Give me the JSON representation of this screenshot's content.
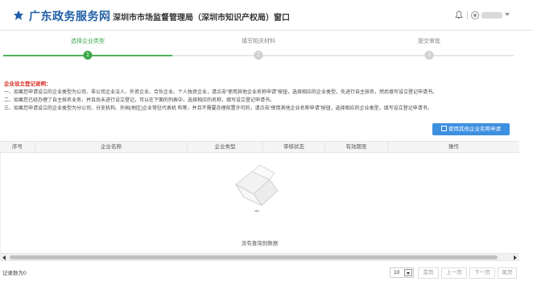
{
  "header": {
    "brand": "广东政务服务网",
    "window_title": "深圳市市场监督管理局（深圳市知识产权局）窗口",
    "logo_icon": "gd-gov-logo-icon",
    "bell_icon": "bell-icon",
    "user_icon": "user-avatar-icon"
  },
  "steps": [
    {
      "label": "选择企业类型",
      "number": "1",
      "state": "active"
    },
    {
      "label": "填写相关材料",
      "number": "2",
      "state": "inactive"
    },
    {
      "label": "提交审批",
      "number": "3",
      "state": "inactive"
    }
  ],
  "notice": {
    "title": "企业设立登记说明：",
    "lines": [
      "一、如果您申请设立的企业类型为公司、非公司企业法人、外资企业、合伙企业、个人独资企业，请点击“使用其他企业名称申请”按钮，选择相应的企业类型，先进行自主核名，然后填写设立登记申请书。",
      "二、如果您已经办理了自主核名业务，并且尚未进行设立登记，可以在下面的列表中，选择相应的名称，填写设立登记申请书。",
      "三、如果您申请设立的企业类型为分公司、分支机构、外国(地区)企业常驻代表机 构等，并且不需要办理前置许可的，请点击“使用其他企业名称申请”按钮，选择相应的企业类型，填写设立登记申请书。"
    ]
  },
  "actions": {
    "use_other_name_label": "使用其他企业名称申请",
    "edit_icon": "edit-icon"
  },
  "table": {
    "columns": [
      "序号",
      "企业名称",
      "企业类型",
      "审核状态",
      "有效期至",
      "操作"
    ],
    "empty_text": "没有查询到数据",
    "empty_icon": "empty-box-icon"
  },
  "footer": {
    "record_count": "记录数为0",
    "page_size": "10",
    "pagination": [
      "首页",
      "上一页",
      "下一页",
      "尾页"
    ]
  },
  "colors": {
    "brand_blue": "#1f5fa8",
    "step_green": "#3aa84a",
    "notice_red": "#d9261c",
    "button_blue": "#3d8fe0"
  }
}
